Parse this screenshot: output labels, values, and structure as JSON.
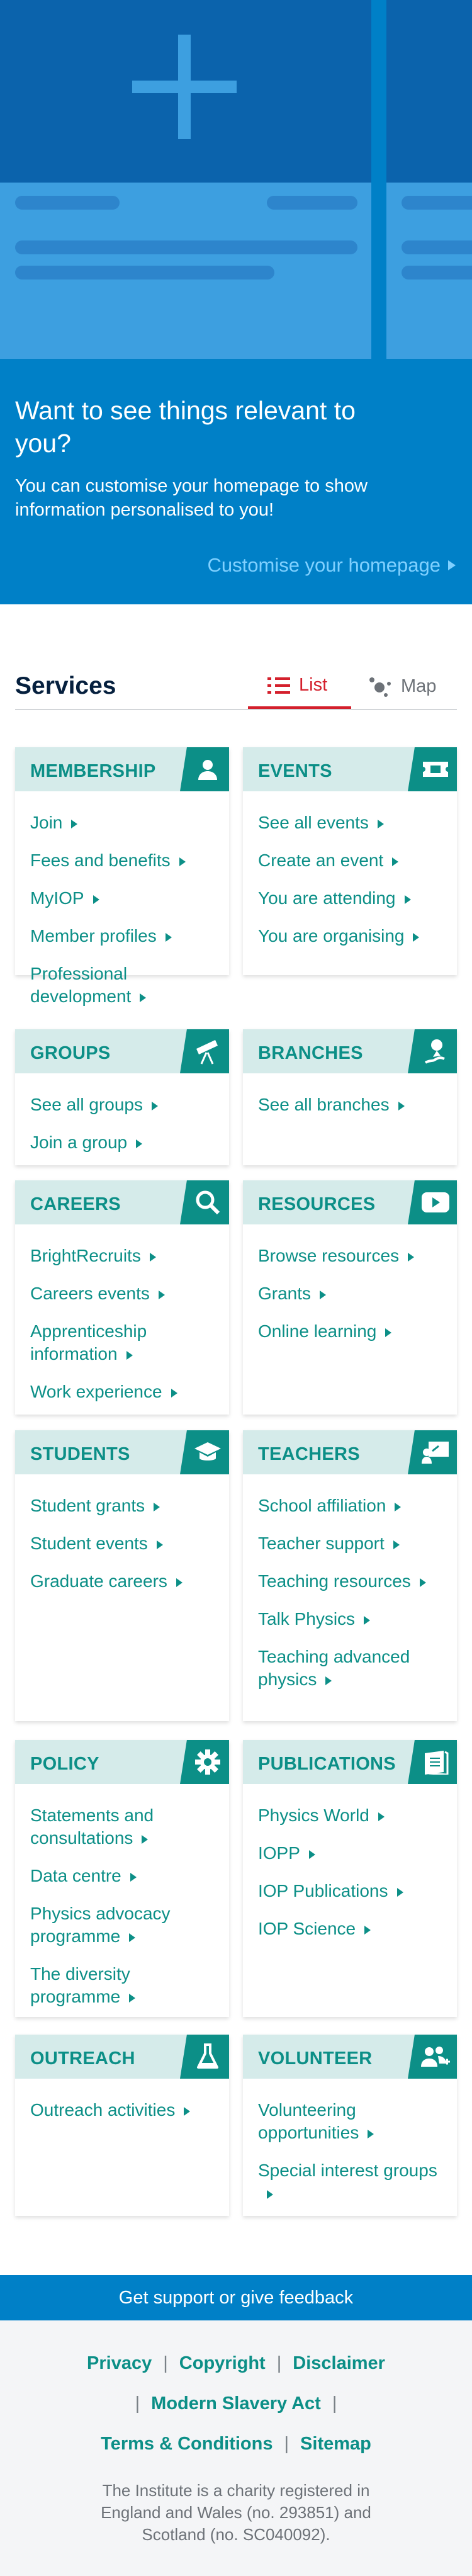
{
  "hero": {
    "heading": "Want to see things relevant to you?",
    "subtext": "You can customise your homepage to show information personalised to you!",
    "customise_link": "Customise your homepage",
    "colors": {
      "background": "#0080c7",
      "card": "#3d9fe0",
      "card_top": "#0b63ac",
      "link": "#7fd0ff"
    }
  },
  "services": {
    "title": "Services",
    "tabs": [
      {
        "label": "List",
        "active": true,
        "icon": "list-icon"
      },
      {
        "label": "Map",
        "active": false,
        "icon": "map-icon"
      }
    ],
    "panels": [
      {
        "title": "MEMBERSHIP",
        "icon": "user-icon",
        "links": [
          "Join",
          "Fees and benefits",
          "MyIOP",
          "Member profiles",
          "Professional development"
        ]
      },
      {
        "title": "EVENTS",
        "icon": "ticket-icon",
        "links": [
          "See all events",
          "Create an event",
          "You are attending",
          "You are organising"
        ]
      },
      {
        "title": "GROUPS",
        "icon": "telescope-icon",
        "links": [
          "See all groups",
          "Join a group"
        ]
      },
      {
        "title": "BRANCHES",
        "icon": "map-pin-icon",
        "links": [
          "See all branches"
        ]
      },
      {
        "title": "CAREERS",
        "icon": "search-icon",
        "links": [
          "BrightRecruits",
          "Careers events",
          "Apprenticeship information",
          "Work experience"
        ]
      },
      {
        "title": "RESOURCES",
        "icon": "play-icon",
        "links": [
          "Browse resources",
          "Grants",
          "Online learning"
        ]
      },
      {
        "title": "STUDENTS",
        "icon": "graduation-cap-icon",
        "links": [
          "Student grants",
          "Student events",
          "Graduate careers"
        ]
      },
      {
        "title": "TEACHERS",
        "icon": "teacher-board-icon",
        "links": [
          "School affiliation",
          "Teacher support",
          "Teaching resources",
          "Talk Physics",
          "Teaching advanced physics"
        ]
      },
      {
        "title": "POLICY",
        "icon": "gear-icon",
        "links": [
          "Statements and consultations",
          "Data centre",
          "Physics advocacy programme",
          "The diversity programme"
        ]
      },
      {
        "title": "PUBLICATIONS",
        "icon": "book-icon",
        "links": [
          "Physics World",
          "IOPP",
          "IOP Publications",
          "IOP Science"
        ]
      },
      {
        "title": "OUTREACH",
        "icon": "flask-icon",
        "links": [
          "Outreach activities"
        ]
      },
      {
        "title": "VOLUNTEER",
        "icon": "people-icon",
        "links": [
          "Volunteering opportunities",
          "Special interest groups"
        ]
      }
    ],
    "colors": {
      "accent": "#0c8f87",
      "header_bg": "#d5ebea",
      "tab_active": "#d4202c"
    }
  },
  "feedback": {
    "label": "Get support or give feedback"
  },
  "footer": {
    "links_row1": [
      "Privacy",
      "Copyright",
      "Disclaimer"
    ],
    "links_row2": [
      "Modern Slavery Act"
    ],
    "links_row3": [
      "Terms & Conditions",
      "Sitemap"
    ],
    "separator": "|",
    "charity": "The Institute is a charity registered in England and Wales (no. 293851) and Scotland (no. SC040092)."
  }
}
